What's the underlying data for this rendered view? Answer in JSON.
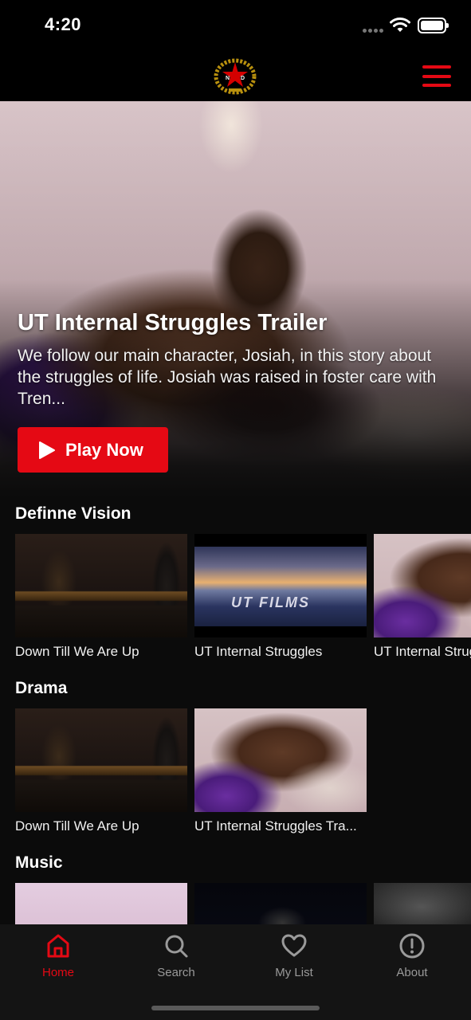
{
  "status_bar": {
    "time": "4:20"
  },
  "header": {
    "logo_icon": "film-studio-laurel-star-logo",
    "menu_icon": "hamburger-menu-icon",
    "accent_color": "#e50914"
  },
  "hero": {
    "title": "UT Internal Struggles Trailer",
    "description": "We follow our main character, Josiah, in this story about the struggles of life. Josiah was raised in foster care with Tren...",
    "play_label": "Play Now"
  },
  "rows": [
    {
      "title": "Definne Vision",
      "items": [
        {
          "title": "Down Till We Are Up"
        },
        {
          "title": "UT Internal Struggles",
          "thumb_text": "UT FILMS"
        },
        {
          "title": "UT Internal Struggles Trailer"
        }
      ]
    },
    {
      "title": "Drama",
      "items": [
        {
          "title": "Down Till We Are Up"
        },
        {
          "title": "UT Internal Struggles Tra..."
        }
      ]
    },
    {
      "title": "Music",
      "items": [
        {
          "title": ""
        },
        {
          "title": ""
        },
        {
          "title": ""
        }
      ]
    }
  ],
  "tabs": [
    {
      "label": "Home",
      "icon": "home-icon",
      "active": true
    },
    {
      "label": "Search",
      "icon": "search-icon",
      "active": false
    },
    {
      "label": "My List",
      "icon": "heart-icon",
      "active": false
    },
    {
      "label": "About",
      "icon": "info-icon",
      "active": false
    }
  ]
}
